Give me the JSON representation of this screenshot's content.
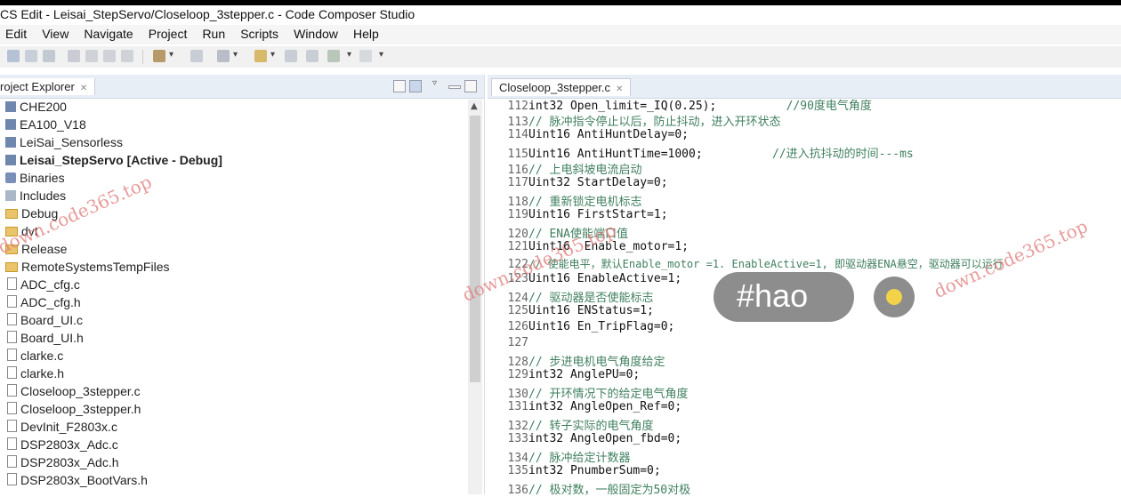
{
  "window": {
    "title": "CS Edit - Leisai_StepServo/Closeloop_3stepper.c - Code Composer Studio"
  },
  "menu": [
    "Edit",
    "View",
    "Navigate",
    "Project",
    "Run",
    "Scripts",
    "Window",
    "Help"
  ],
  "project_explorer": {
    "tab_label": "roject Explorer",
    "items": [
      {
        "label": "CHE200",
        "kind": "proj"
      },
      {
        "label": "EA100_V18",
        "kind": "proj"
      },
      {
        "label": "LeiSai_Sensorless",
        "kind": "proj"
      },
      {
        "label": "Leisai_StepServo  [Active - Debug]",
        "kind": "proj",
        "active": true
      },
      {
        "label": "Binaries",
        "kind": "bin"
      },
      {
        "label": "Includes",
        "kind": "inc"
      },
      {
        "label": "Debug",
        "kind": "folder"
      },
      {
        "label": "dvt",
        "kind": "folder"
      },
      {
        "label": "Release",
        "kind": "folder"
      },
      {
        "label": "RemoteSystemsTempFiles",
        "kind": "folder"
      },
      {
        "label": "ADC_cfg.c",
        "kind": "file"
      },
      {
        "label": "ADC_cfg.h",
        "kind": "file"
      },
      {
        "label": "Board_UI.c",
        "kind": "file"
      },
      {
        "label": "Board_UI.h",
        "kind": "file"
      },
      {
        "label": "clarke.c",
        "kind": "file"
      },
      {
        "label": "clarke.h",
        "kind": "file"
      },
      {
        "label": "Closeloop_3stepper.c",
        "kind": "file"
      },
      {
        "label": "Closeloop_3stepper.h",
        "kind": "file"
      },
      {
        "label": "DevInit_F2803x.c",
        "kind": "file"
      },
      {
        "label": "DSP2803x_Adc.c",
        "kind": "file"
      },
      {
        "label": "DSP2803x_Adc.h",
        "kind": "file"
      },
      {
        "label": "DSP2803x_BootVars.h",
        "kind": "file"
      }
    ]
  },
  "editor": {
    "tab_label": "Closeloop_3stepper.c",
    "lines": [
      {
        "n": "112",
        "code": "int32 Open_limit=_IQ(0.25);",
        "comment": "          //90度电气角度"
      },
      {
        "n": "113",
        "code": "",
        "comment": "// 脉冲指令停止以后，防止抖动，进入开环状态"
      },
      {
        "n": "114",
        "code": "Uint16 AntiHuntDelay=0;",
        "comment": ""
      },
      {
        "n": "115",
        "code": "Uint16 AntiHuntTime=1000;",
        "comment": "          //进入抗抖动的时间---ms"
      },
      {
        "n": "116",
        "code": "",
        "comment": "// 上电斜坡电流启动"
      },
      {
        "n": "117",
        "code": "Uint32 StartDelay=0;",
        "comment": ""
      },
      {
        "n": "118",
        "code": "",
        "comment": "// 重新锁定电机标志"
      },
      {
        "n": "119",
        "code": "Uint16 FirstStart=1;",
        "comment": ""
      },
      {
        "n": "120",
        "code": "",
        "comment": "// ENA使能端口值"
      },
      {
        "n": "121",
        "code": "Uint16  Enable_motor=1;",
        "comment": ""
      },
      {
        "n": "122",
        "code": "",
        "comment": "// 使能电平，默认Enable_motor =1. EnableActive=1, 即驱动器ENA悬空，驱动器可以运行"
      },
      {
        "n": "123",
        "code": "Uint16 EnableActive=1;",
        "comment": ""
      },
      {
        "n": "124",
        "code": "",
        "comment": "// 驱动器是否使能标志"
      },
      {
        "n": "125",
        "code": "Uint16 ENStatus=1;",
        "comment": ""
      },
      {
        "n": "126",
        "code": "Uint16 En_TripFlag=0;",
        "comment": ""
      },
      {
        "n": "127",
        "code": "",
        "comment": ""
      },
      {
        "n": "128",
        "code": "",
        "comment": "// 步进电机电气角度给定"
      },
      {
        "n": "129",
        "code": "int32 AnglePU=0;",
        "comment": ""
      },
      {
        "n": "130",
        "code": "",
        "comment": "// 开环情况下的给定电气角度"
      },
      {
        "n": "131",
        "code": "int32 AngleOpen_Ref=0;",
        "comment": ""
      },
      {
        "n": "132",
        "code": "",
        "comment": "// 转子实际的电气角度"
      },
      {
        "n": "133",
        "code": "int32 AngleOpen_fbd=0;",
        "comment": ""
      },
      {
        "n": "134",
        "code": "",
        "comment": "// 脉冲给定计数器"
      },
      {
        "n": "135",
        "code": "int32 PnumberSum=0;",
        "comment": ""
      },
      {
        "n": "136",
        "code": "",
        "comment": "// 极对数，一般固定为50对极"
      }
    ]
  },
  "overlay": {
    "hashtag": "#hao"
  },
  "watermarks": [
    "down.code365.top",
    "down.code365.top",
    "down.code365.top"
  ],
  "colors": {
    "comment": "#3f7f5f",
    "tab_bar": "#e8eef6",
    "watermark": "#e07a7a"
  }
}
